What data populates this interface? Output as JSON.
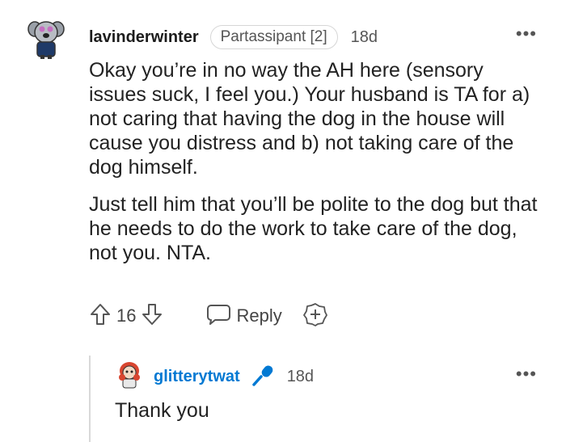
{
  "comment": {
    "username": "lavinderwinter",
    "flair": "Partassipant [2]",
    "time": "18d",
    "more_label": "•••",
    "paragraphs": [
      "Okay you’re in no way the AH here (sensory issues suck, I feel you.) Your husband is TA for a) not caring that having the dog in the house will cause you distress and b) not taking care of the dog himself.",
      "Just tell him that you’ll be polite to the dog but that he needs to do the work to take care of the dog, not you. NTA."
    ],
    "votes": "16",
    "reply_label": "Reply",
    "icons": {
      "upvote": "upvote-arrow-icon",
      "downvote": "downvote-arrow-icon",
      "reply": "speech-bubble-icon",
      "award": "add-award-icon",
      "avatar": "koala-avatar"
    }
  },
  "reply": {
    "username": "glitterytwat",
    "time": "18d",
    "more_label": "•••",
    "text": "Thank you",
    "icons": {
      "badge": "microphone-icon",
      "avatar": "redhead-avatar"
    },
    "colors": {
      "username": "#0079d3"
    }
  }
}
